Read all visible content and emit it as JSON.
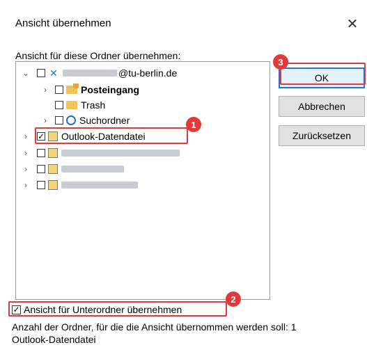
{
  "dialog": {
    "title": "Ansicht übernehmen",
    "close_glyph": "✕"
  },
  "tree": {
    "label": "Ansicht für diese Ordner übernehmen:",
    "account_suffix": "@tu-berlin.de",
    "items": [
      {
        "label": "Posteingang",
        "icon": "inbox-icon"
      },
      {
        "label": "Trash",
        "icon": "folder-icon"
      },
      {
        "label": "Suchordner",
        "icon": "search-folder-icon"
      },
      {
        "label": "Outlook-Datendatei",
        "icon": "data-file-icon"
      }
    ]
  },
  "buttons": {
    "ok": "OK",
    "cancel": "Abbrechen",
    "reset": "Zurücksetzen"
  },
  "subfolder": {
    "label": "Ansicht für Unterordner übernehmen",
    "checked": true
  },
  "info": {
    "count_line": "Anzahl der Ordner, für die die Ansicht übernommen werden soll: 1",
    "selected_name": "Outlook-Datendatei"
  },
  "badges": [
    "1",
    "2",
    "3"
  ],
  "colors": {
    "annotation_red": "#e03a3a",
    "ok_border": "#2b71d3"
  }
}
